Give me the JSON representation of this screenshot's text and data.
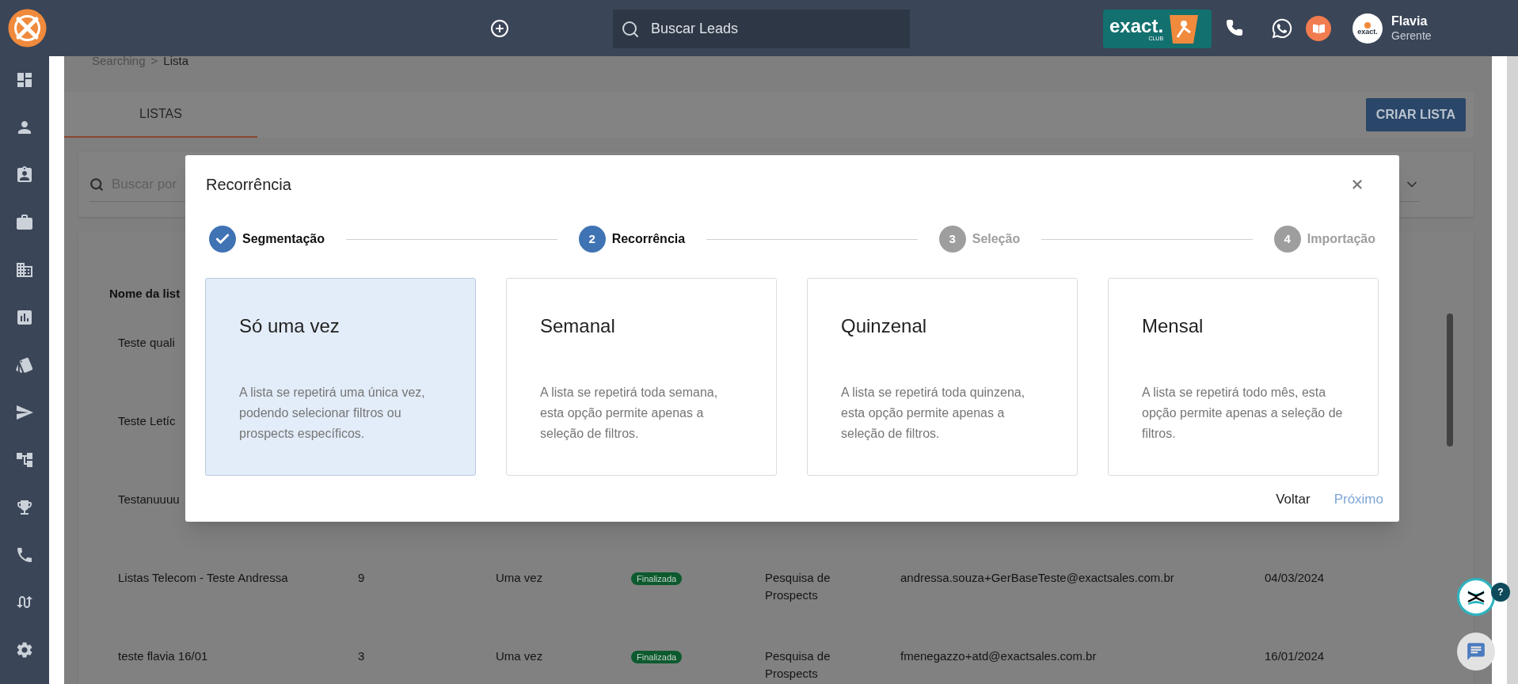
{
  "topbar": {
    "search_placeholder": "Buscar Leads",
    "club_badge": {
      "brand": "exact.",
      "sub": "CLUB"
    },
    "user": {
      "avatar_text": "exact.",
      "name": "Flavia",
      "role": "Gerente"
    }
  },
  "breadcrumb": {
    "items": [
      "Searching",
      "Lista"
    ],
    "separator": ">"
  },
  "tabs": [
    {
      "label": "LISTAS",
      "selected": true
    }
  ],
  "create_button": "CRIAR LISTA",
  "search": {
    "placeholder": "Buscar por"
  },
  "table": {
    "columns": [
      "Nome da list"
    ],
    "rows": [
      {
        "name": "Teste quali"
      },
      {
        "name": "Teste Letíc"
      },
      {
        "name": "Testanuuuu"
      },
      {
        "name": "Listas Telecom - Teste Andressa",
        "count": "9",
        "recurrence": "Uma vez",
        "status": "Finalizada",
        "origin": "Pesquisa de Prospects",
        "email": "andressa.souza+GerBaseTeste@exactsales.com.br",
        "date": "04/03/2024"
      },
      {
        "name": "teste flavia 16/01",
        "count": "3",
        "recurrence": "Uma vez",
        "status": "Finalizada",
        "origin": "Pesquisa de Prospects",
        "email": "fmenegazzo+atd@exactsales.com.br",
        "date": "16/01/2024"
      }
    ]
  },
  "modal": {
    "title": "Recorrência",
    "steps": [
      {
        "label": "Segmentação",
        "completed": true,
        "selected": false
      },
      {
        "number": "2",
        "label": "Recorrência",
        "completed": false,
        "selected": true
      },
      {
        "number": "3",
        "label": "Seleção",
        "completed": false,
        "selected": false
      },
      {
        "number": "4",
        "label": "Importação",
        "completed": false,
        "selected": false
      }
    ],
    "options": [
      {
        "title": "Só uma vez",
        "description": "A lista se repetirá uma única vez, podendo selecionar filtros ou prospects específicos.",
        "selected": true
      },
      {
        "title": "Semanal",
        "description": "A lista se repetirá toda semana, esta opção permite apenas a seleção de filtros.",
        "selected": false
      },
      {
        "title": "Quinzenal",
        "description": "A lista se repetirá toda quinzena, esta opção permite apenas a seleção de filtros.",
        "selected": false
      },
      {
        "title": "Mensal",
        "description": "A lista se repetirá todo mês, esta opção permite apenas a seleção de filtros.",
        "selected": false
      }
    ],
    "back_button": "Voltar",
    "next_button": "Próximo"
  },
  "help_badge": "?"
}
